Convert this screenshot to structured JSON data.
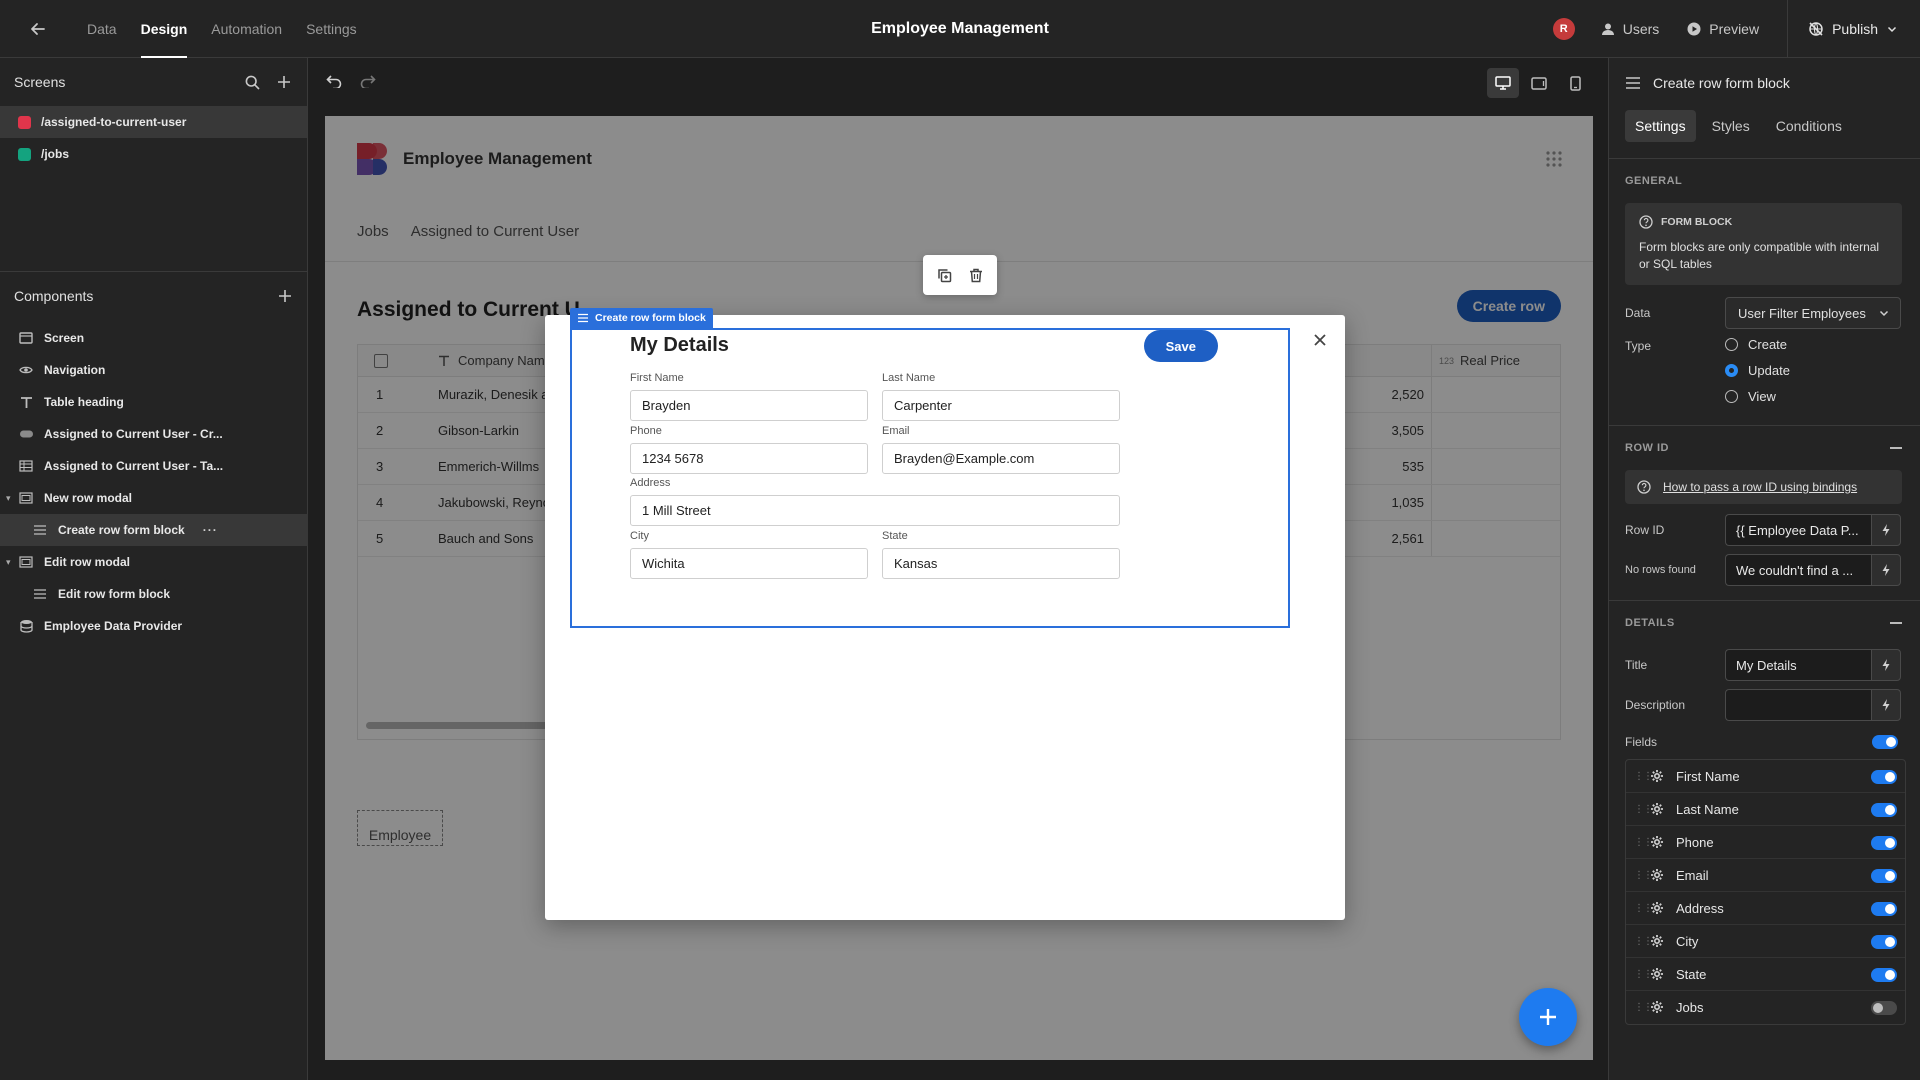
{
  "topbar": {
    "tabs": [
      {
        "label": "Data",
        "active": false
      },
      {
        "label": "Design",
        "active": true
      },
      {
        "label": "Automation",
        "active": false
      },
      {
        "label": "Settings",
        "active": false
      }
    ],
    "title": "Employee Management",
    "avatar_initial": "R",
    "users_label": "Users",
    "preview_label": "Preview",
    "publish_label": "Publish"
  },
  "screens": {
    "title": "Screens",
    "items": [
      {
        "label": "/assigned-to-current-user",
        "color": "#e0354b",
        "selected": true
      },
      {
        "label": "/jobs",
        "color": "#14a37f",
        "selected": false
      }
    ]
  },
  "components": {
    "title": "Components",
    "items": [
      {
        "label": "Screen",
        "icon": "screen-icon",
        "level": 0
      },
      {
        "label": "Navigation",
        "icon": "eye-icon",
        "level": 0
      },
      {
        "label": "Table heading",
        "icon": "text-icon",
        "level": 0
      },
      {
        "label": "Assigned to Current User - Cr...",
        "icon": "button-icon",
        "level": 0
      },
      {
        "label": "Assigned to Current User - Ta...",
        "icon": "table-icon",
        "level": 0
      },
      {
        "label": "New row modal",
        "icon": "modal-icon",
        "level": 0
      },
      {
        "label": "Create row form block",
        "icon": "form-icon",
        "level": 1
      },
      {
        "label": "Edit row modal",
        "icon": "modal-icon",
        "level": 0
      },
      {
        "label": "Edit row form block",
        "icon": "form-icon",
        "level": 1
      },
      {
        "label": "Employee Data Provider",
        "icon": "database-icon",
        "level": 0
      }
    ]
  },
  "app": {
    "name": "Employee Management",
    "nav": [
      "Jobs",
      "Assigned to Current User"
    ],
    "heading": "Assigned to Current U",
    "create_row_label": "Create row",
    "table": {
      "col_company": "Company Name",
      "col_price": "Real Price",
      "col_price_type": "123",
      "rows": [
        {
          "idx": "1",
          "name": "Murazik, Denesik and",
          "num": "2,520"
        },
        {
          "idx": "2",
          "name": "Gibson-Larkin",
          "num": "3,505"
        },
        {
          "idx": "3",
          "name": "Emmerich-Willms",
          "num": "535"
        },
        {
          "idx": "4",
          "name": "Jakubowski, Reynold",
          "num": "1,035"
        },
        {
          "idx": "5",
          "name": "Bauch and Sons",
          "num": "2,561"
        }
      ]
    },
    "employee_slot": "Employee"
  },
  "form": {
    "tag": "Create row form block",
    "title": "My Details",
    "save_label": "Save",
    "first_name_label": "First Name",
    "first_name": "Brayden",
    "last_name_label": "Last Name",
    "last_name": "Carpenter",
    "phone_label": "Phone",
    "phone": "1234 5678",
    "email_label": "Email",
    "email": "Brayden@Example.com",
    "address_label": "Address",
    "address": "1 Mill Street",
    "city_label": "City",
    "city": "Wichita",
    "state_label": "State",
    "state": "Kansas"
  },
  "settings": {
    "panel_title": "Create row form block",
    "tabs": [
      {
        "label": "Settings",
        "active": true
      },
      {
        "label": "Styles",
        "active": false
      },
      {
        "label": "Conditions",
        "active": false
      }
    ],
    "general_title": "GENERAL",
    "info_heading": "FORM BLOCK",
    "info_text": "Form blocks are only compatible with internal or SQL tables",
    "data_label": "Data",
    "data_value": "User Filter Employees",
    "type_label": "Type",
    "type_options": [
      {
        "label": "Create",
        "selected": false
      },
      {
        "label": "Update",
        "selected": true
      },
      {
        "label": "View",
        "selected": false
      }
    ],
    "row_id_title": "ROW ID",
    "row_id_link": "How to pass a row ID using bindings",
    "row_id_label": "Row ID",
    "row_id_value": "{{ Employee Data P...",
    "no_rows_label": "No rows found",
    "no_rows_value": "We couldn't find a ...",
    "details_title": "DETAILS",
    "title_label": "Title",
    "title_value": "My Details",
    "description_label": "Description",
    "description_value": "",
    "fields_label": "Fields",
    "fields": [
      {
        "label": "First Name",
        "on": true
      },
      {
        "label": "Last Name",
        "on": true
      },
      {
        "label": "Phone",
        "on": true
      },
      {
        "label": "Email",
        "on": true
      },
      {
        "label": "Address",
        "on": true
      },
      {
        "label": "City",
        "on": true
      },
      {
        "label": "State",
        "on": true
      },
      {
        "label": "Jobs",
        "on": false
      }
    ]
  },
  "colors": {
    "accent": "#1e7bf0",
    "selection": "#2a6fdb",
    "primary_button": "#1e5fc4"
  }
}
